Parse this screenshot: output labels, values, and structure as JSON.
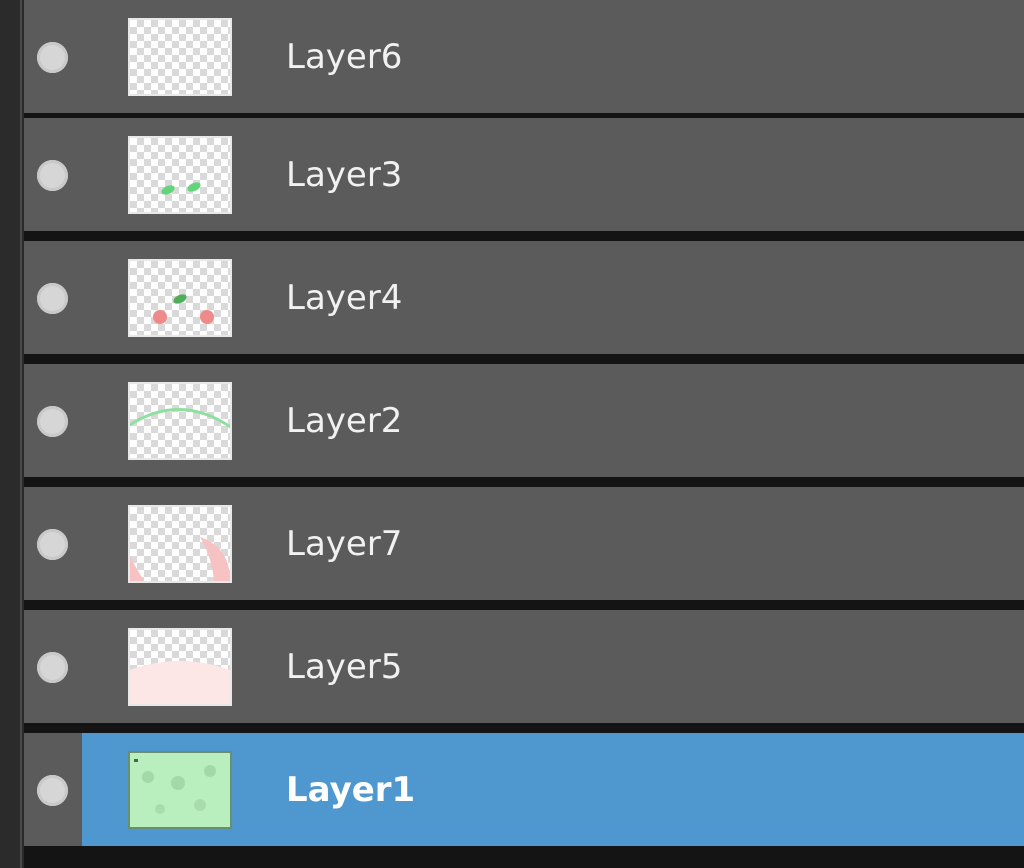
{
  "layers_panel": {
    "layers": [
      {
        "name": "Layer6",
        "visible": true,
        "selected": false,
        "thumbnail": "empty"
      },
      {
        "name": "Layer3",
        "visible": true,
        "selected": false,
        "thumbnail": "green-dots"
      },
      {
        "name": "Layer4",
        "visible": true,
        "selected": false,
        "thumbnail": "red-green-dots"
      },
      {
        "name": "Layer2",
        "visible": true,
        "selected": false,
        "thumbnail": "green-arc"
      },
      {
        "name": "Layer7",
        "visible": true,
        "selected": false,
        "thumbnail": "pink-corners"
      },
      {
        "name": "Layer5",
        "visible": true,
        "selected": false,
        "thumbnail": "pink-fill"
      },
      {
        "name": "Layer1",
        "visible": true,
        "selected": true,
        "thumbnail": "green-fill"
      }
    ]
  },
  "colors": {
    "row_bg": "#5b5b5b",
    "selected_bg": "#4f97cf",
    "separator": "#141414",
    "text": "#f1f1f1"
  }
}
